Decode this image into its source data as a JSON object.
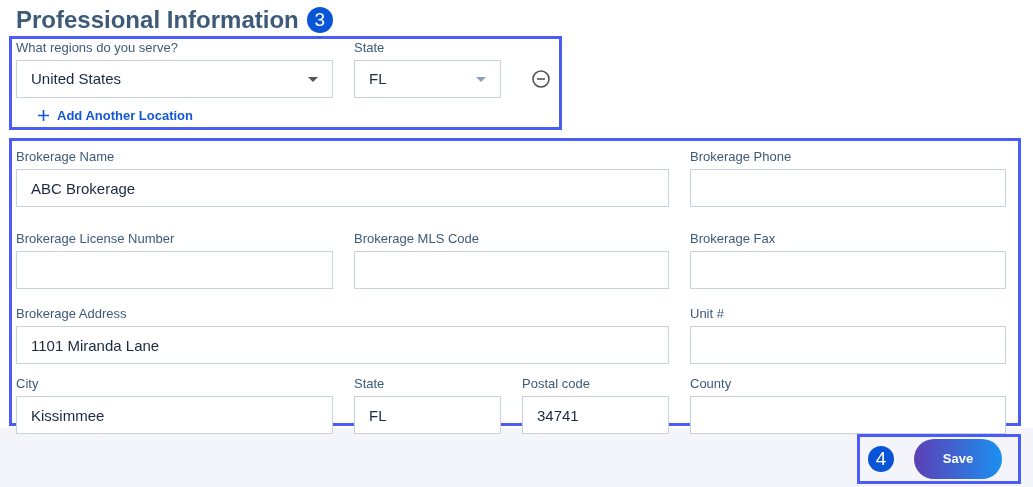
{
  "heading": {
    "title": "Professional Information",
    "step_badge": "3"
  },
  "location_section": {
    "fields": [
      {
        "label": "What regions do you serve?",
        "value": "United States",
        "kind": "select"
      },
      {
        "label": "State",
        "value": "FL",
        "kind": "select"
      }
    ],
    "add_link": "Add Another Location"
  },
  "brokerage_rows": [
    [
      {
        "label": "Brokerage Name",
        "value": "ABC Brokerage"
      },
      {
        "label": "Brokerage Phone"
      }
    ],
    [
      {
        "label": "Brokerage License Number"
      },
      {
        "label": "Brokerage MLS Code"
      },
      {
        "label": "Brokerage Fax"
      }
    ],
    [
      {
        "label": "Brokerage Address",
        "value": "1101 Miranda Lane"
      },
      {
        "label": "Unit #"
      }
    ],
    [
      {
        "label": "City",
        "value": "Kissimmee"
      },
      {
        "label": "State",
        "value": "FL"
      },
      {
        "label": "Postal code",
        "value": "34741"
      },
      {
        "label": "County"
      }
    ]
  ],
  "footer": {
    "step_badge": "4",
    "save_button": "Save"
  }
}
